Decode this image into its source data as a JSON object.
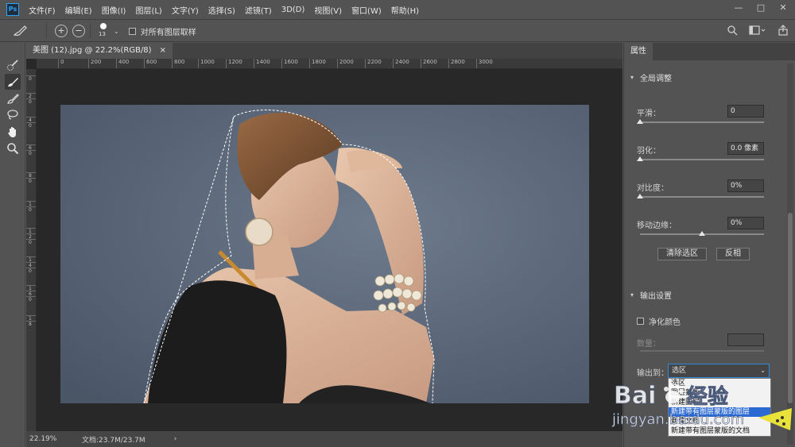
{
  "app": {
    "logo": "Ps"
  },
  "menu": [
    "文件(F)",
    "编辑(E)",
    "图像(I)",
    "图层(L)",
    "文字(Y)",
    "选择(S)",
    "滤镜(T)",
    "3D(D)",
    "视图(V)",
    "窗口(W)",
    "帮助(H)"
  ],
  "window_controls": {
    "minimize": "—",
    "maximize": "□",
    "close": "✕"
  },
  "options": {
    "brush_size": "13",
    "sample_all_layers_label": "对所有图层取样",
    "sample_all_layers_checked": false
  },
  "document": {
    "tab_title": "美图 (12).jpg @ 22.2%(RGB/8)",
    "tab_close": "×",
    "ruler_h": [
      "0",
      "200",
      "400",
      "600",
      "800",
      "1000",
      "1200",
      "1400",
      "1600",
      "1800",
      "2000",
      "2200",
      "2400",
      "2600",
      "2800",
      "3000"
    ],
    "ruler_v": [
      "0",
      "2",
      "0",
      "4",
      "0",
      "6",
      "0",
      "8",
      "0",
      "1",
      "0",
      "1",
      "2",
      "0",
      "1",
      "4",
      "0",
      "1",
      "6",
      "0",
      "1",
      "8"
    ]
  },
  "status": {
    "zoom": "22.19%",
    "doc_info": "文档:23.7M/23.7M",
    "arrow": "›"
  },
  "panel": {
    "tab": "属性",
    "global_adjust": {
      "title": "全局调整",
      "smooth_label": "平滑：",
      "smooth_value": "0",
      "smooth_level": 0,
      "feather_label": "羽化：",
      "feather_value": "0.0 像素",
      "feather_level": 0,
      "contrast_label": "对比度：",
      "contrast_value": "0%",
      "contrast_level": 0,
      "shift_edge_label": "移动边缘：",
      "shift_edge_value": "0%",
      "shift_edge_level": 0.5,
      "clear_selection": "清除选区",
      "invert": "反相"
    },
    "output": {
      "title": "输出设置",
      "decontaminate_label": "净化颜色",
      "decontaminate_checked": false,
      "amount_label": "数量：",
      "output_to_label": "输出到：",
      "output_selected": "选区",
      "options": [
        "选区",
        "图层蒙版",
        "新建图层",
        "新建带有图层蒙版的图层",
        "新建文档",
        "新建带有图层蒙版的文档"
      ],
      "highlighted_index": 3
    }
  },
  "watermark": {
    "brand": "Bai",
    "brand2": "经验",
    "url": "jingyan.baidu.com"
  },
  "colors": {
    "ui_bg": "#535353",
    "canvas_bg": "#282828",
    "accent": "#2b6ad3",
    "focus": "#2f8bd8"
  },
  "icons": [
    "ps-logo-icon",
    "brush-icon",
    "add-icon",
    "subtract-icon",
    "brush-size-icon",
    "search-icon",
    "workspace-icon",
    "share-icon",
    "quick-selection-icon",
    "refine-brush-icon",
    "brush-tool-icon",
    "lasso-icon",
    "hand-icon",
    "zoom-icon",
    "chevron-down-icon"
  ]
}
